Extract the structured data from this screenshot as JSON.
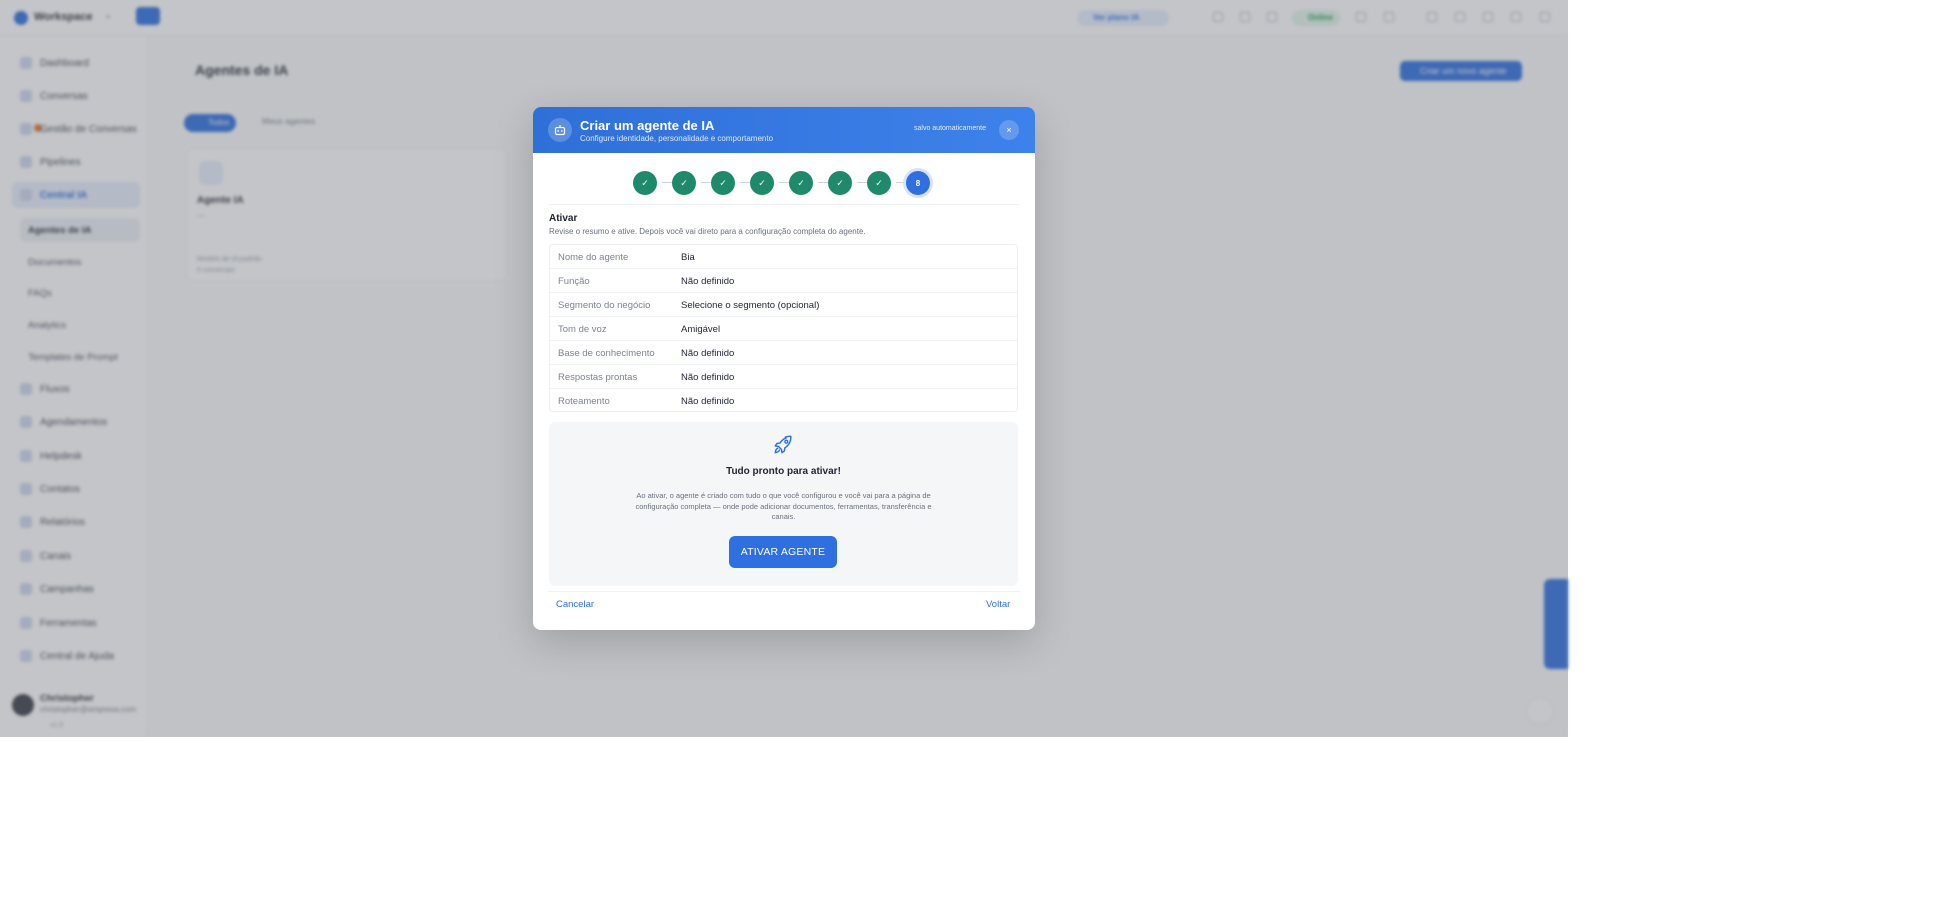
{
  "topbar": {
    "workspace": "Workspace",
    "plan_badge": "Ver plano IA",
    "status_badge": "Online"
  },
  "sidebar": {
    "items": [
      {
        "label": "Dashboard"
      },
      {
        "label": "Conversas"
      },
      {
        "label": "Gestão de Conversas"
      },
      {
        "label": "Pipelines"
      },
      {
        "label": "Central IA"
      }
    ],
    "subitems": [
      {
        "label": "Agentes de IA"
      },
      {
        "label": "Documentos"
      },
      {
        "label": "FAQs"
      },
      {
        "label": "Analytics"
      },
      {
        "label": "Templates de Prompt"
      }
    ],
    "items_lower": [
      {
        "label": "Fluxos"
      },
      {
        "label": "Agendamentos"
      },
      {
        "label": "Helpdesk"
      },
      {
        "label": "Contatos"
      },
      {
        "label": "Relatórios"
      },
      {
        "label": "Canais"
      },
      {
        "label": "Campanhas"
      },
      {
        "label": "Ferramentas"
      },
      {
        "label": "Central de Ajuda"
      }
    ],
    "user": {
      "name": "Christopher",
      "email": "christopher@empresa.com",
      "version": "v1.0"
    }
  },
  "page": {
    "title": "Agentes de IA",
    "create_button": "Criar um novo agente",
    "filters": [
      "Todos",
      "Meus agentes"
    ],
    "card": {
      "name": "Agente IA",
      "dash": "—",
      "meta1": "Modelo de IA padrão",
      "meta2": "0 conversas"
    }
  },
  "modal": {
    "title": "Criar um agente de IA",
    "subtitle": "Configure identidade, personalidade e comportamento",
    "saved": "salvo automaticamente",
    "close_icon": "×",
    "steps": [
      "✓",
      "✓",
      "✓",
      "✓",
      "✓",
      "✓",
      "✓",
      "8"
    ],
    "section_title": "Ativar",
    "section_desc": "Revise o resumo e ative. Depois você vai direto para a configuração completa do agente.",
    "summary": [
      {
        "label": "Nome do agente",
        "value": "Bia"
      },
      {
        "label": "Função",
        "value": "Não definido"
      },
      {
        "label": "Segmento do negócio",
        "value": "Selecione o segmento (opcional)"
      },
      {
        "label": "Tom de voz",
        "value": "Amigável"
      },
      {
        "label": "Base de conhecimento",
        "value": "Não definido"
      },
      {
        "label": "Respostas prontas",
        "value": "Não definido"
      },
      {
        "label": "Roteamento",
        "value": "Não definido"
      }
    ],
    "ready_title": "Tudo pronto para ativar!",
    "ready_desc": "Ao ativar, o agente é criado com tudo o que você configurou e você vai para a página de configuração completa — onde pode adicionar documentos, ferramentas, transferência e canais.",
    "activate_button": "ATIVAR AGENTE",
    "cancel_button": "Cancelar",
    "back_button": "Voltar",
    "icons": {
      "header": "robot-icon",
      "ready": "rocket-icon"
    },
    "colors": {
      "primary": "#2f6fe0",
      "step_done": "#1f8a6b"
    }
  }
}
